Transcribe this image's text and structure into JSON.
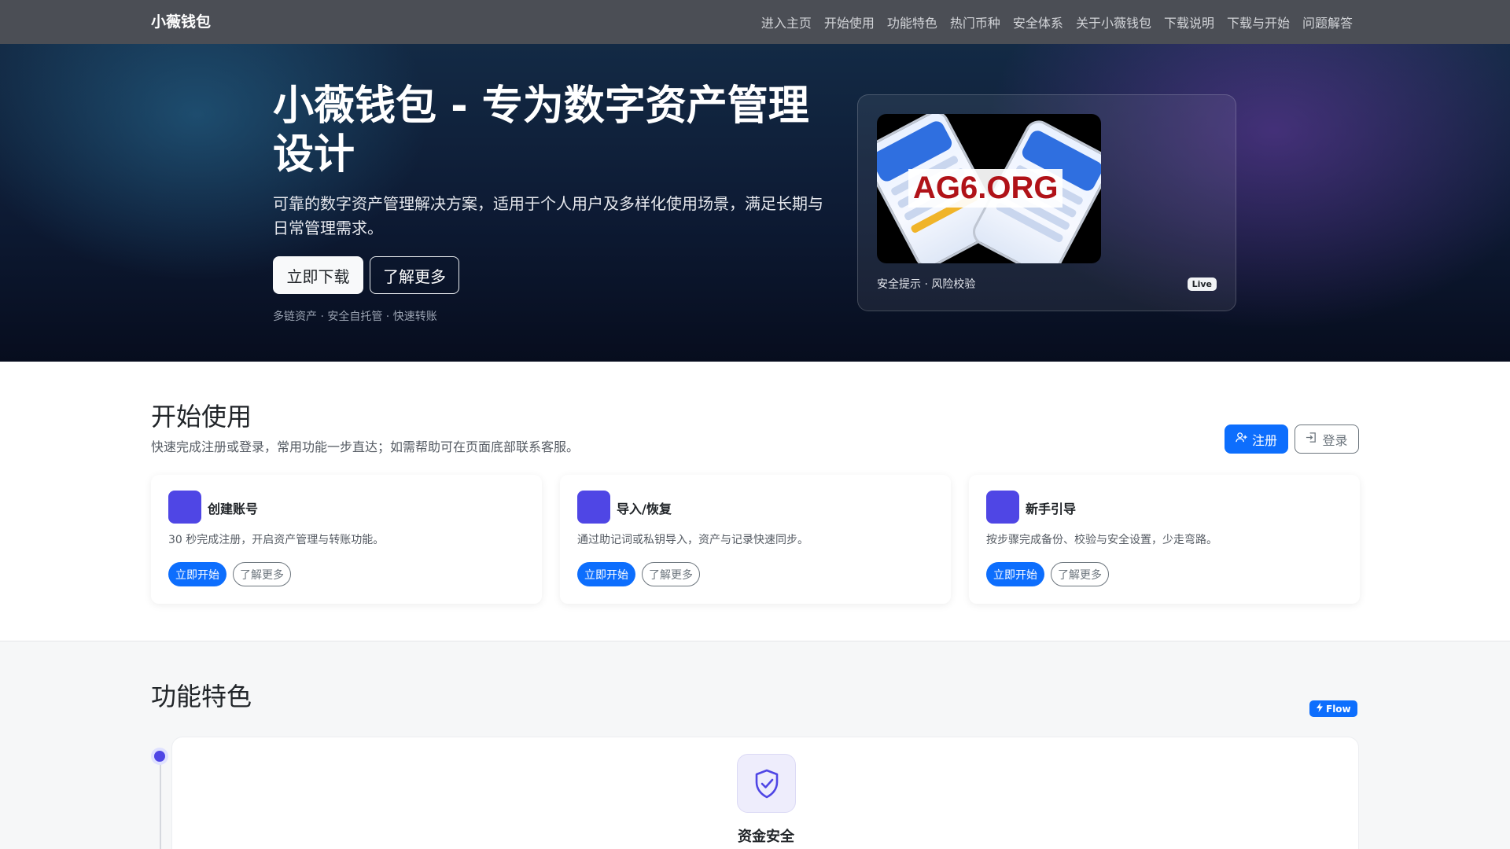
{
  "nav": {
    "brand": "小薇钱包",
    "links": [
      "进入主页",
      "开始使用",
      "功能特色",
      "热门币种",
      "安全体系",
      "关于小薇钱包",
      "下载说明",
      "下载与开始",
      "问题解答"
    ]
  },
  "hero": {
    "title": "小薇钱包 - 专为数字资产管理设计",
    "subtitle": "可靠的数字资产管理解决方案，适用于个人用户及多样化使用场景，满足长期与日常管理需求。",
    "download_label": "立即下载",
    "more_label": "了解更多",
    "tags": "多链资产 · 安全自托管 · 快速转账",
    "card": {
      "promo_text": "AG6.ORG",
      "caption": "安全提示 · 风险校验",
      "badge": "Live"
    }
  },
  "start": {
    "title": "开始使用",
    "subtitle": "快速完成注册或登录，常用功能一步直达；如需帮助可在页面底部联系客服。",
    "register_label": "注册",
    "login_label": "登录",
    "cards": [
      {
        "title": "创建账号",
        "desc": "30 秒完成注册，开启资产管理与转账功能。",
        "start_label": "立即开始",
        "more_label": "了解更多"
      },
      {
        "title": "导入/恢复",
        "desc": "通过助记词或私钥导入，资产与记录快速同步。",
        "start_label": "立即开始",
        "more_label": "了解更多"
      },
      {
        "title": "新手引导",
        "desc": "按步骤完成备份、校验与安全设置，少走弯路。",
        "start_label": "立即开始",
        "more_label": "了解更多"
      }
    ]
  },
  "features": {
    "title": "功能特色",
    "badge": "Flow",
    "items": [
      {
        "name": "资金安全",
        "icon": "shield-check-icon"
      }
    ]
  },
  "colors": {
    "primary": "#0d6efd",
    "accent": "#4f46e5",
    "navbar": "#4b4e55"
  }
}
